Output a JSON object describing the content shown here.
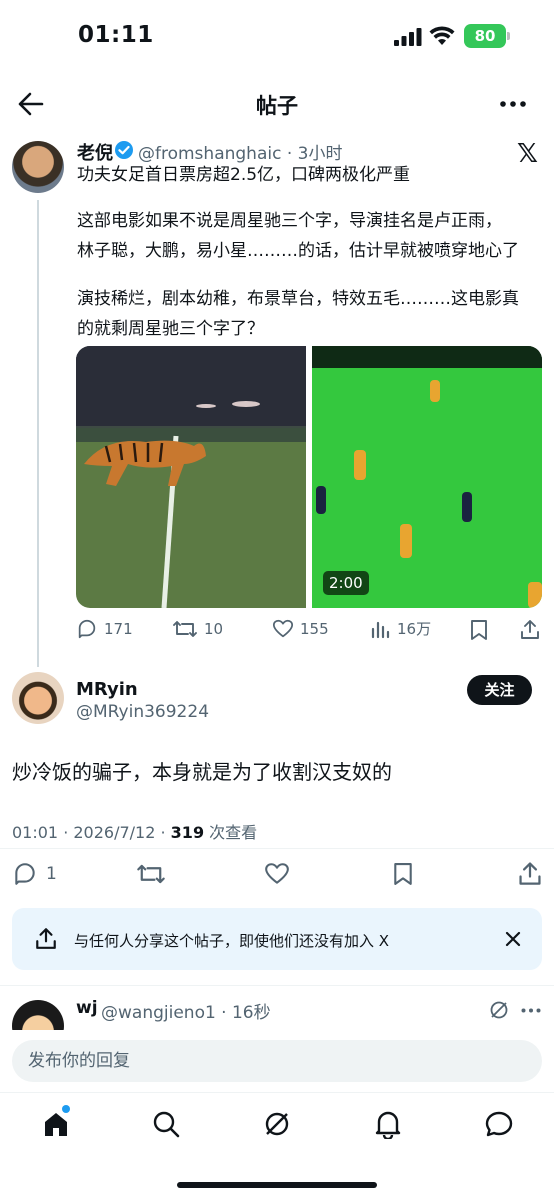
{
  "status_bar": {
    "time": "01:11",
    "battery": "80"
  },
  "header": {
    "title": "帖子"
  },
  "tweet": {
    "author": "老倪",
    "handle_time": "@fromshanghaic · 3小时",
    "lines": [
      "功夫女足首日票房超2.5亿，口碑两极化严重",
      "这部电影如果不说是周星驰三个字，导演挂名是卢正雨，",
      "林子聪，大鹏，易小星………的话，估计早就被喷穿地心了",
      "演技稀烂，剧本幼稚，布景草台，特效五毛………这电影真",
      "的就剩周星驰三个字了？"
    ],
    "video_duration": "2:00",
    "stats": {
      "replies": "171",
      "retweets": "10",
      "likes": "155",
      "views": "16万"
    }
  },
  "reply": {
    "author": "MRyin",
    "handle": "@MRyin369224",
    "follow_label": "关注",
    "text": "炒冷饭的骗子，本身就是为了收割汉支奴的",
    "meta_time": "01:01 · 2026/7/12 · ",
    "meta_views": "319",
    "meta_views_label": " 次查看",
    "stats": {
      "replies": "1"
    }
  },
  "share_banner": {
    "text": "与任何人分享这个帖子，即使他们还没有加入 X"
  },
  "next_reply": {
    "author": "wj",
    "handle_time": "@wangjieno1 · 16秒"
  },
  "composer": {
    "placeholder": "发布你的回复"
  },
  "colors": {
    "accent": "#1d9bf0",
    "text": "#0f1419",
    "muted": "#536471",
    "battery": "#34c759"
  }
}
